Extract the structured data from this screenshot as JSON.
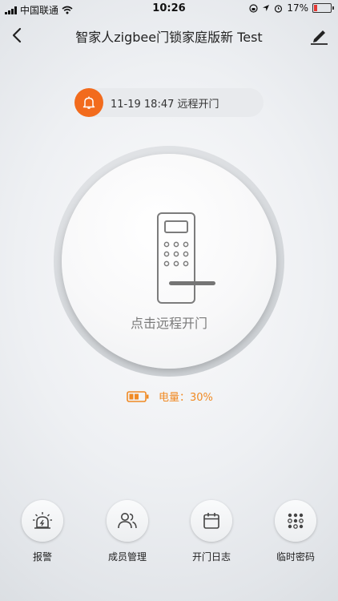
{
  "status_bar": {
    "carrier": "中国联通",
    "time": "10:26",
    "battery_percent": "17%"
  },
  "navbar": {
    "title": "智家人zigbee门锁家庭版新 Test"
  },
  "notification": {
    "text": "11-19 18:47  远程开门"
  },
  "lock": {
    "action_label": "点击远程开门"
  },
  "battery": {
    "label": "电量：30%"
  },
  "actions": [
    {
      "label": "报警",
      "icon": "alarm-icon"
    },
    {
      "label": "成员管理",
      "icon": "members-icon"
    },
    {
      "label": "开门日志",
      "icon": "calendar-icon"
    },
    {
      "label": "临时密码",
      "icon": "keypad-icon"
    }
  ],
  "colors": {
    "accent": "#f26b1d",
    "battery_text": "#f08a24",
    "low_battery": "#e53935"
  }
}
